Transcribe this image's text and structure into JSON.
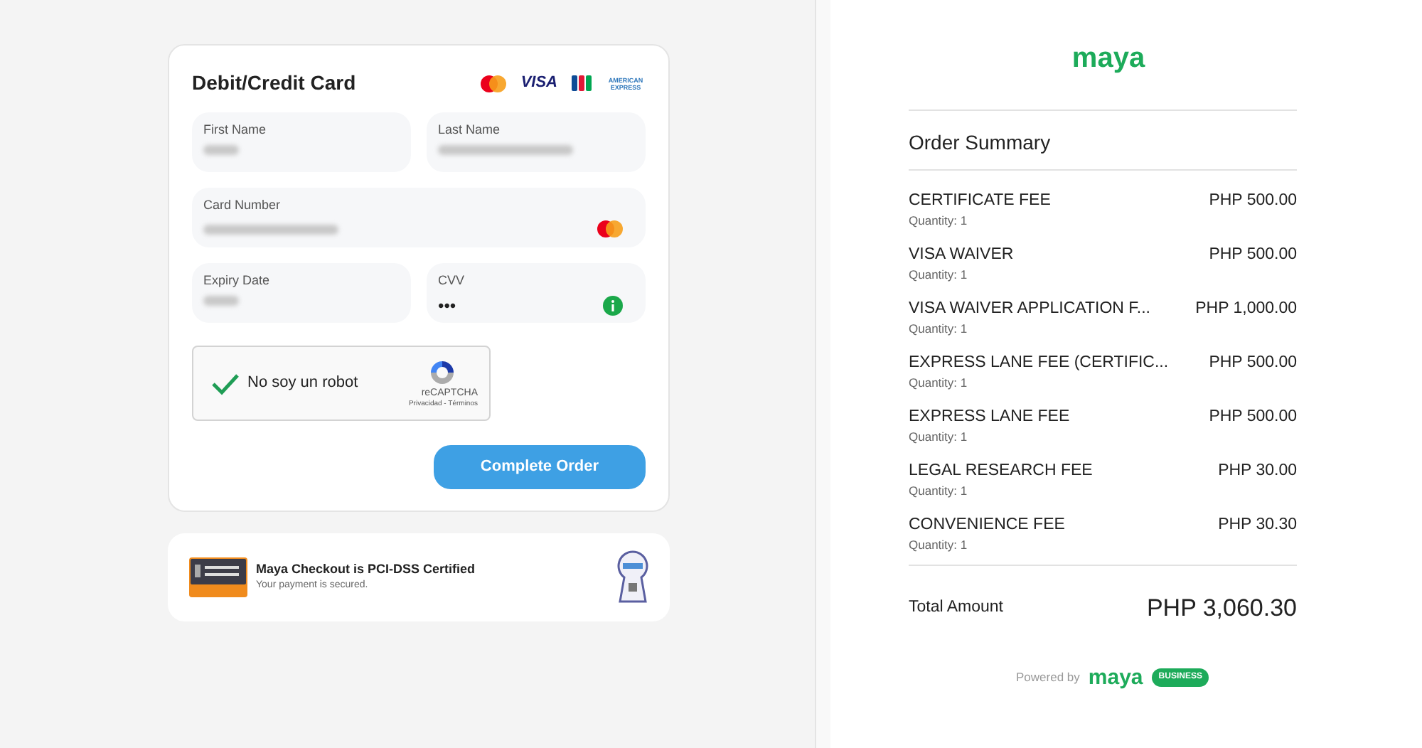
{
  "payment_card": {
    "title": "Debit/Credit Card",
    "brands": [
      {
        "kind": "mastercard"
      },
      {
        "kind": "visa",
        "label": "VISA"
      },
      {
        "kind": "jcb"
      },
      {
        "kind": "amex",
        "label": "AMERICAN EXPRESS"
      }
    ],
    "fields": [
      {
        "label": "First Name",
        "kind": "firstname"
      },
      {
        "label": "Last Name",
        "kind": "lastname"
      },
      {
        "label": "Card Number",
        "kind": "cardnumber"
      },
      {
        "label": "Expiry Date",
        "kind": "expiry"
      },
      {
        "label": "CVV",
        "kind": "cvv",
        "value": "•••"
      }
    ],
    "captcha": {
      "label": "No soy un robot",
      "checked": true,
      "brand": "reCAPTCHA",
      "links": "Privacidad - Términos"
    },
    "submit": "Complete Order"
  },
  "security": {
    "title": "Maya Checkout is PCI-DSS Certified",
    "subtitle": "Your payment is secured."
  },
  "summary": {
    "logo": "maya",
    "title": "Order Summary",
    "items": [
      {
        "name": "CERTIFICATE FEE",
        "quantity": "Quantity: 1",
        "price": "PHP 500.00"
      },
      {
        "name": "VISA WAIVER",
        "quantity": "Quantity: 1",
        "price": "PHP 500.00"
      },
      {
        "name": "VISA WAIVER APPLICATION F...",
        "quantity": "Quantity: 1",
        "price": "PHP 1,000.00"
      },
      {
        "name": "EXPRESS LANE FEE (CERTIFIC...",
        "quantity": "Quantity: 1",
        "price": "PHP 500.00"
      },
      {
        "name": "EXPRESS LANE FEE",
        "quantity": "Quantity: 1",
        "price": "PHP 500.00"
      },
      {
        "name": "LEGAL RESEARCH FEE",
        "quantity": "Quantity: 1",
        "price": "PHP 30.00"
      },
      {
        "name": "CONVENIENCE FEE",
        "quantity": "Quantity: 1",
        "price": "PHP 30.30"
      }
    ],
    "total_label": "Total Amount",
    "total": "PHP 3,060.30",
    "powered_by": "Powered by",
    "powered_logo": "maya",
    "powered_badge": "BUSINESS"
  }
}
